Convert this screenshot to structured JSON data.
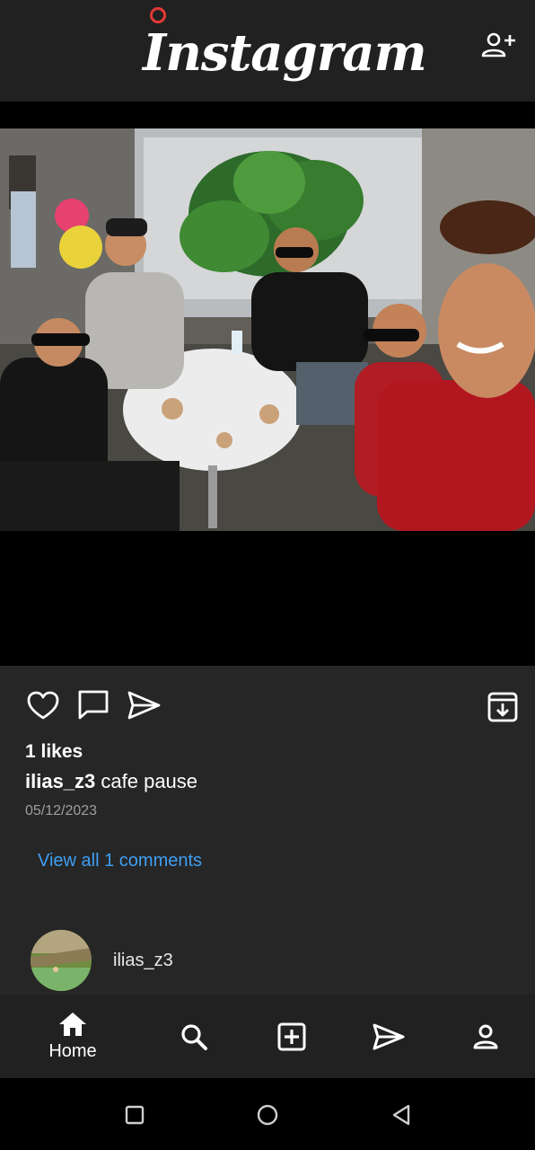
{
  "app": {
    "logo_text": "Instagram"
  },
  "post": {
    "likes_text": "1 likes",
    "caption_user": "ilias_z3",
    "caption_text": " cafe pause",
    "date": "05/12/2023",
    "view_comments": "View all 1 comments"
  },
  "comment": {
    "username": "ilias_z3"
  },
  "nav": {
    "home_label": "Home"
  },
  "icons": {
    "header": [
      "add-user-icon"
    ],
    "actions": [
      "heart-icon",
      "comment-icon",
      "share-icon",
      "archive-icon"
    ],
    "nav": [
      "home-icon",
      "search-icon",
      "add-post-icon",
      "direct-icon",
      "profile-icon"
    ],
    "system": [
      "recents-icon",
      "home-circle-icon",
      "back-icon"
    ]
  },
  "colors": {
    "bar_bg": "#212121",
    "panel_bg": "#262626",
    "link": "#3e9ff2",
    "date": "#9e9e9e"
  }
}
